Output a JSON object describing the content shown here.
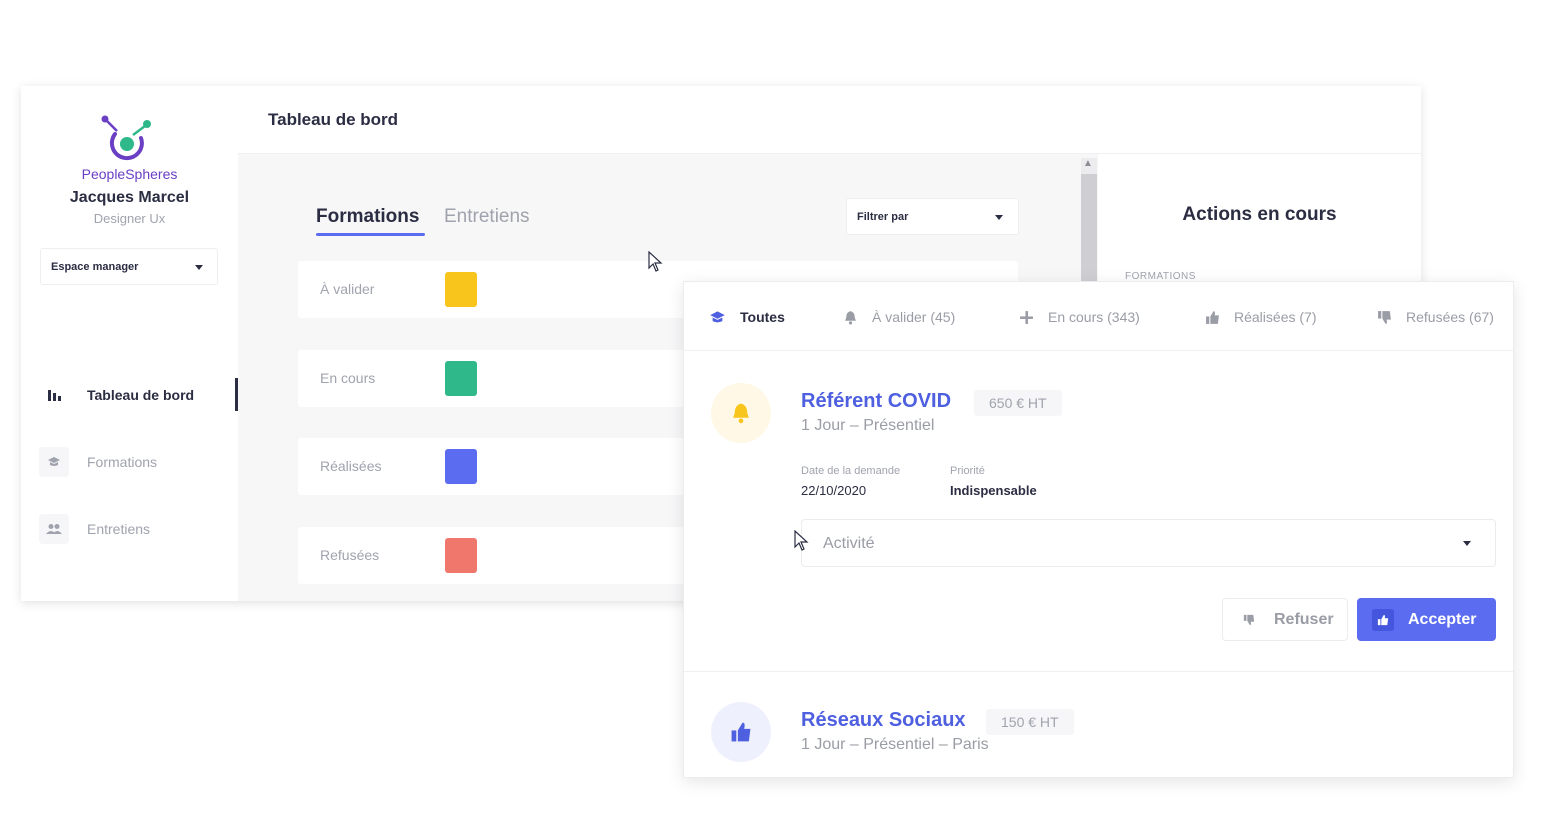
{
  "brand": {
    "name": "PeopleSpheres"
  },
  "user": {
    "name": "Jacques Marcel",
    "role": "Designer Ux"
  },
  "space_select": {
    "value": "Espace manager"
  },
  "sidebar": {
    "items": [
      {
        "label": "Tableau de bord",
        "icon": "bar-chart-icon",
        "active": true
      },
      {
        "label": "Formations",
        "icon": "graduation-cap-icon",
        "active": false
      },
      {
        "label": "Entretiens",
        "icon": "users-icon",
        "active": false
      }
    ]
  },
  "header": {
    "title": "Tableau de bord"
  },
  "main": {
    "tabs": [
      {
        "label": "Formations",
        "active": true
      },
      {
        "label": "Entretiens",
        "active": false
      }
    ],
    "filter": {
      "value": "Filtrer par"
    },
    "status_rows": [
      {
        "label": "À valider",
        "color": "#f8c51c"
      },
      {
        "label": "En cours",
        "color": "#2fb889"
      },
      {
        "label": "Réalisées",
        "color": "#5b6cf0"
      },
      {
        "label": "Refusées",
        "color": "#f0776b"
      }
    ]
  },
  "actions_panel": {
    "title": "Actions en cours",
    "section": "FORMATIONS"
  },
  "card": {
    "tabs": [
      {
        "label": "Toutes",
        "icon": "graduation-cap-icon",
        "active": true
      },
      {
        "label": "À valider (45)",
        "icon": "bell-icon",
        "active": false
      },
      {
        "label": "En cours (343)",
        "icon": "plus-icon",
        "active": false
      },
      {
        "label": "Réalisées (7)",
        "icon": "thumbs-up-icon",
        "active": false
      },
      {
        "label": "Refusées (67)",
        "icon": "thumbs-down-icon",
        "active": false
      }
    ],
    "items": [
      {
        "title": "Référent COVID",
        "price": "650 € HT",
        "subtitle": "1 Jour – Présentiel",
        "icon": "bell-icon",
        "date_label": "Date de la demande",
        "date_value": "22/10/2020",
        "priority_label": "Priorité",
        "priority_value": "Indispensable",
        "activity_placeholder": "Activité",
        "refuse_label": "Refuser",
        "accept_label": "Accepter"
      },
      {
        "title": "Réseaux Sociaux",
        "price": "150 € HT",
        "subtitle": "1 Jour – Présentiel – Paris",
        "icon": "thumbs-up-icon"
      }
    ]
  },
  "colors": {
    "accent": "#5b6cf0",
    "text_dark": "#2b2d42",
    "text_muted": "#a0a3ad",
    "brand_purple": "#6a3fc4",
    "brand_green": "#2fb889",
    "warning_yellow": "#f8c51c",
    "danger_red": "#f0776b"
  }
}
